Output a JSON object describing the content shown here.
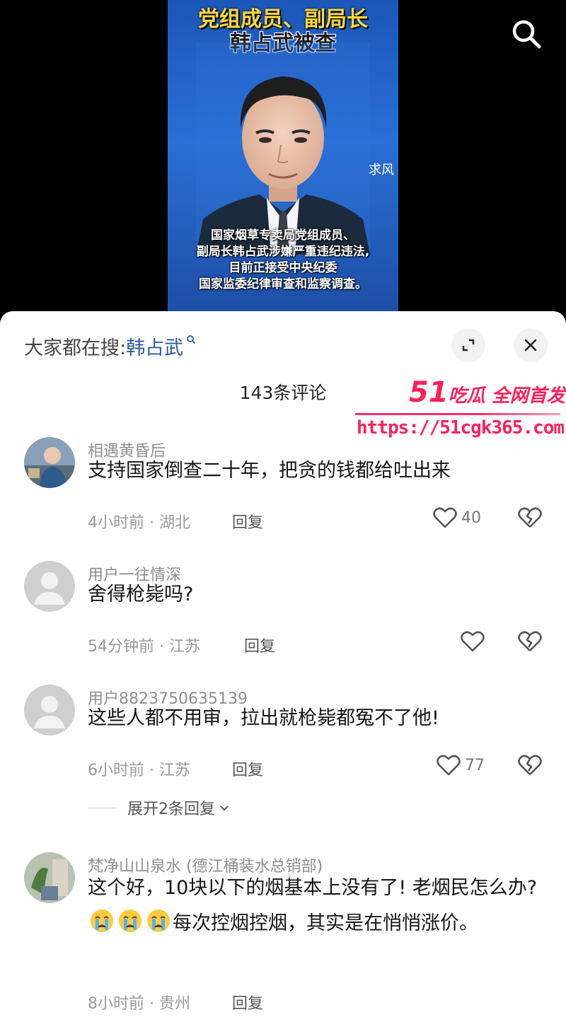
{
  "video": {
    "headline_line1": "党组成员、副局长",
    "headline_line2": "韩占武被查",
    "side_text": "求风",
    "caption_lines": [
      "国家烟草专卖局党组成员、",
      "副局长韩占武涉嫌严重违纪违法,",
      "目前正接受中央纪委",
      "国家监委纪律审查和监察调查。"
    ],
    "search_icon": "search-icon"
  },
  "sheet": {
    "hot_search_prefix": "大家都在搜:",
    "hot_search_term": "韩占武",
    "comment_count": "143条评论",
    "expand_icon": "expand-icon",
    "close_icon": "close-icon"
  },
  "watermark": {
    "brand": "51",
    "tagline": "吃瓜 全网首发",
    "url": "https://51cgk365.com"
  },
  "comments": [
    {
      "user": "相遇黄昏后",
      "text": "支持国家倒查二十年，把贪的钱都给吐出来",
      "time": "4小时前 · 湖北",
      "reply_label": "回复",
      "likes": "40"
    },
    {
      "user": "用户一往情深",
      "text": "舍得枪毙吗?",
      "time": "54分钟前 · 江苏",
      "reply_label": "回复",
      "likes": ""
    },
    {
      "user": "用户8823750635139",
      "text": "这些人都不用审，拉出就枪毙都冤不了他!",
      "time": "6小时前 · 江苏",
      "reply_label": "回复",
      "likes": "77",
      "expand_replies": "展开2条回复"
    },
    {
      "user": "梵净山山泉水 (德江桶装水总销部)",
      "text_part1": "这个好，10块以下的烟基本上没有了! 老烟民怎么办?",
      "text_part2": "每次控烟控烟，其实是在悄悄涨价。",
      "time": "8小时前 · 贵州",
      "reply_label": "回复"
    }
  ],
  "colors": {
    "accent_link": "#2d5a9b",
    "watermark": "#ff1f5a",
    "video_bg": "#2a6fd6"
  }
}
